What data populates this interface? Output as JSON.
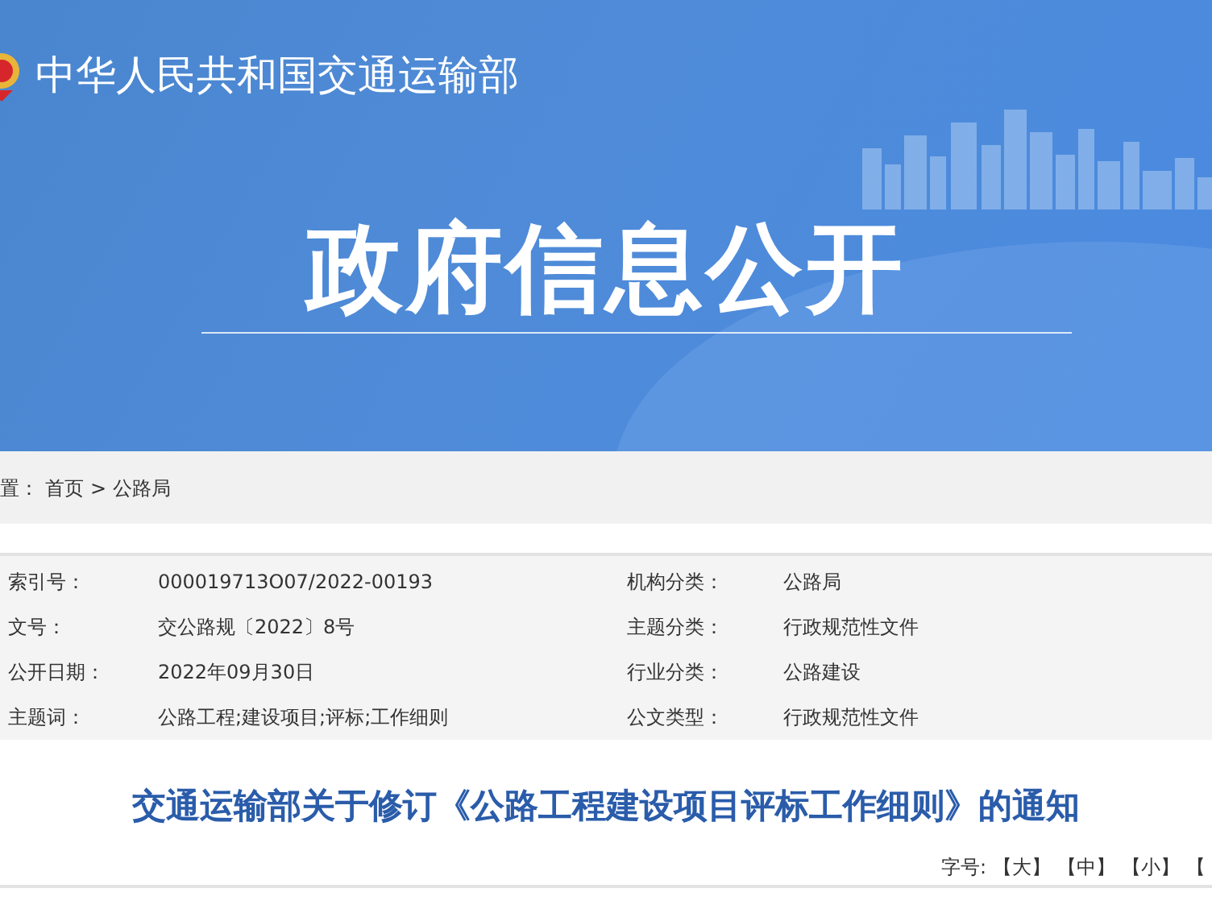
{
  "header": {
    "site_name": "中华人民共和国交通运输部",
    "banner_title": "政府信息公开"
  },
  "breadcrumb": {
    "prefix": "置：",
    "items": [
      "首页",
      "公路局"
    ],
    "separator": ">"
  },
  "meta_rows": [
    {
      "left": {
        "label": "索引号：",
        "value": "000019713O07/2022-00193"
      },
      "right": {
        "label": "机构分类：",
        "value": "公路局"
      }
    },
    {
      "left": {
        "label": "文号：",
        "value": "交公路规〔2022〕8号"
      },
      "right": {
        "label": "主题分类：",
        "value": "行政规范性文件"
      }
    },
    {
      "left": {
        "label": "公开日期：",
        "value": "2022年09月30日"
      },
      "right": {
        "label": "行业分类：",
        "value": "公路建设"
      }
    },
    {
      "left": {
        "label": "主题词：",
        "value": "公路工程;建设项目;评标;工作细则"
      },
      "right": {
        "label": "公文类型：",
        "value": "行政规范性文件"
      }
    }
  ],
  "article": {
    "title": "交通运输部关于修订《公路工程建设项目评标工作细则》的通知"
  },
  "font_size": {
    "label": "字号:",
    "options": [
      "【大】",
      "【中】",
      "【小】",
      "【"
    ]
  }
}
